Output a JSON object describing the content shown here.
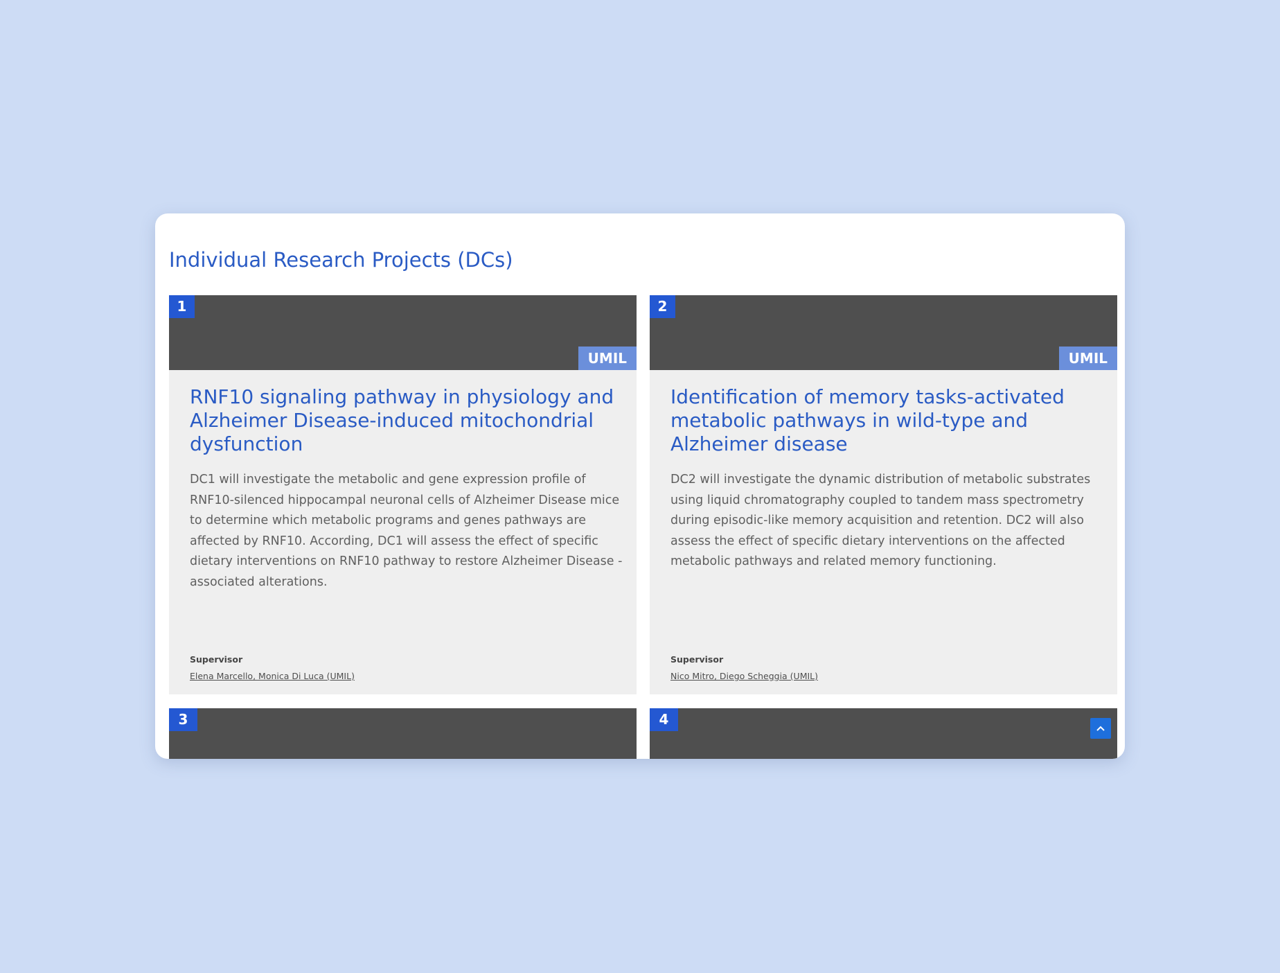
{
  "page": {
    "title": "Individual Research Projects (DCs)"
  },
  "projects": [
    {
      "number": "1",
      "institution": "UMIL",
      "title": "RNF10 signaling pathway in physiology and Alzheimer Disease-induced mitochondrial dysfunction",
      "description": "DC1 will investigate the metabolic and gene expression profile of RNF10-silenced hippocampal neuronal cells of Alzheimer Disease mice to determine which metabolic programs and genes pathways are affected by RNF10. According, DC1 will assess the effect of specific dietary interventions on RNF10 pathway to restore Alzheimer Disease -associated alterations.",
      "supervisor_label": "Supervisor",
      "supervisors": "Elena Marcello, Monica Di Luca (UMIL)"
    },
    {
      "number": "2",
      "institution": "UMIL",
      "title": "Identification of memory tasks-activated metabolic pathways in wild-type and Alzheimer disease",
      "description": "DC2 will investigate the dynamic distribution of metabolic substrates using liquid chromatography coupled to tandem mass spectrometry during episodic-like memory acquisition and retention. DC2 will also assess the effect of specific dietary interventions on the affected metabolic pathways and related memory functioning.",
      "supervisor_label": "Supervisor",
      "supervisors": "Nico Mitro, Diego Scheggia (UMIL)"
    },
    {
      "number": "3"
    },
    {
      "number": "4"
    }
  ],
  "scroll_top": {
    "icon": "chevron-up-icon"
  },
  "colors": {
    "background": "#cddcf5",
    "accent": "#2a5bc4",
    "badge": "#2458d2",
    "institution_tag": "#6b8fdb",
    "card_header": "#4f4f4f",
    "card_body": "#efefef",
    "scroll_top_button": "#1e6fdc"
  }
}
